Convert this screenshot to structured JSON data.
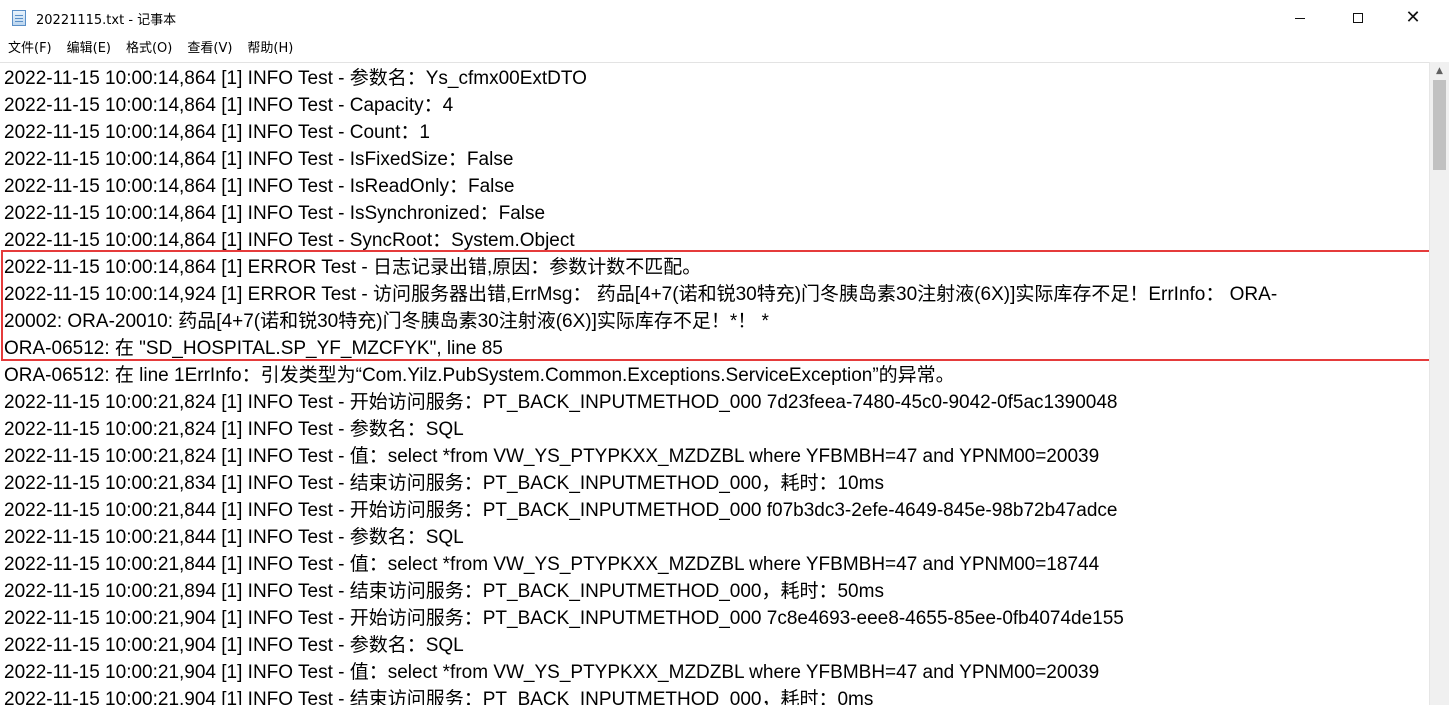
{
  "window": {
    "title": "20221115.txt - 记事本",
    "icon": "notepad-icon",
    "controls": {
      "minimize_icon": "minimize-icon",
      "maximize_icon": "maximize-icon",
      "close_icon": "close-icon",
      "close_glyph": "✕"
    }
  },
  "menu": {
    "items": [
      {
        "label": "文件(F)"
      },
      {
        "label": "编辑(E)"
      },
      {
        "label": "格式(O)"
      },
      {
        "label": "查看(V)"
      },
      {
        "label": "帮助(H)"
      }
    ]
  },
  "editor": {
    "lines": [
      "2022-11-15 10:00:14,864 [1] INFO  Test - 参数名：Ys_cfmx00ExtDTO",
      "2022-11-15 10:00:14,864 [1] INFO  Test - Capacity：4",
      "2022-11-15 10:00:14,864 [1] INFO  Test - Count：1",
      "2022-11-15 10:00:14,864 [1] INFO  Test - IsFixedSize：False",
      "2022-11-15 10:00:14,864 [1] INFO  Test - IsReadOnly：False",
      "2022-11-15 10:00:14,864 [1] INFO  Test - IsSynchronized：False",
      "2022-11-15 10:00:14,864 [1] INFO  Test - SyncRoot：System.Object",
      "2022-11-15 10:00:14,864 [1] ERROR Test - 日志记录出错,原因：参数计数不匹配。",
      "2022-11-15 10:00:14,924 [1] ERROR Test - 访问服务器出错,ErrMsg：  药品[4+7(诺和锐30特充)门冬胰岛素30注射液(6X)]实际库存不足！ErrInfo：  ORA-",
      "20002: ORA-20010: 药品[4+7(诺和锐30特充)门冬胰岛素30注射液(6X)]实际库存不足！*！ *",
      "ORA-06512: 在 \"SD_HOSPITAL.SP_YF_MZCFYK\", line 85",
      "ORA-06512: 在 line 1ErrInfo：引发类型为“Com.Yilz.PubSystem.Common.Exceptions.ServiceException”的异常。",
      "2022-11-15 10:00:21,824 [1] INFO  Test - 开始访问服务：PT_BACK_INPUTMETHOD_000 7d23feea-7480-45c0-9042-0f5ac1390048",
      "2022-11-15 10:00:21,824 [1] INFO  Test - 参数名：SQL",
      "2022-11-15 10:00:21,824 [1] INFO  Test - 值：select *from VW_YS_PTYPKXX_MZDZBL where YFBMBH=47 and YPNM00=20039",
      "2022-11-15 10:00:21,834 [1] INFO  Test - 结束访问服务：PT_BACK_INPUTMETHOD_000，耗时：10ms",
      "2022-11-15 10:00:21,844 [1] INFO  Test - 开始访问服务：PT_BACK_INPUTMETHOD_000 f07b3dc3-2efe-4649-845e-98b72b47adce",
      "2022-11-15 10:00:21,844 [1] INFO  Test - 参数名：SQL",
      "2022-11-15 10:00:21,844 [1] INFO  Test - 值：select *from VW_YS_PTYPKXX_MZDZBL where YFBMBH=47 and YPNM00=18744",
      "2022-11-15 10:00:21,894 [1] INFO  Test - 结束访问服务：PT_BACK_INPUTMETHOD_000，耗时：50ms",
      "2022-11-15 10:00:21,904 [1] INFO  Test - 开始访问服务：PT_BACK_INPUTMETHOD_000 7c8e4693-eee8-4655-85ee-0fb4074de155",
      "2022-11-15 10:00:21,904 [1] INFO  Test - 参数名：SQL",
      "2022-11-15 10:00:21,904 [1] INFO  Test - 值：select *from VW_YS_PTYPKXX_MZDZBL where YFBMBH=47 and YPNM00=20039",
      "2022-11-15 10:00:21,904 [1] INFO  Test - 结束访问服务：PT_BACK_INPUTMETHOD_000，耗时：0ms"
    ],
    "highlight_color": "#e53b3b"
  },
  "scrollbar": {
    "up_icon": "scroll-up-arrow-icon",
    "up_glyph": "▲"
  }
}
